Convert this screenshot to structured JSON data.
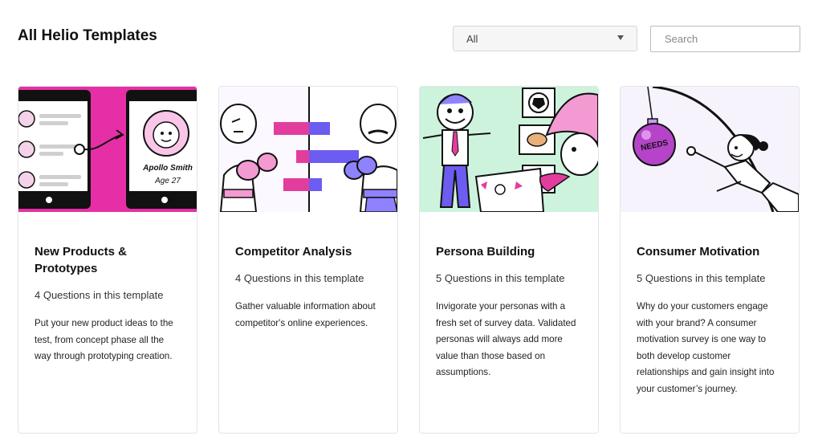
{
  "header": {
    "title": "All Helio Templates",
    "filter_value": "All",
    "search_placeholder": "Search"
  },
  "cards": [
    {
      "title": "New Products & Prototypes",
      "questions": "4 Questions in this template",
      "description": "Put your new product ideas to the test, from concept phase all the way through prototyping creation.",
      "thumb_text_name": "Apollo Smith",
      "thumb_text_age": "Age 27",
      "thumb_bg": "#e62fa6"
    },
    {
      "title": "Competitor Analysis",
      "questions": "4 Questions in this template",
      "description": "Gather valuable information about competitor's online experiences.",
      "thumb_bg": "#f4f0ff"
    },
    {
      "title": "Persona Building",
      "questions": "5 Questions in this template",
      "description": "Invigorate your personas with a fresh set of survey data. Validated personas will always add more value than those based on assumptions.",
      "thumb_bg": "#cdf3dc"
    },
    {
      "title": "Consumer Motivation",
      "questions": "5 Questions in this template",
      "description": "Why do your customers engage with your brand? A consumer motivation survey is one way to both develop customer relationships and gain insight into your customer’s journey.",
      "thumb_badge": "NEEDS",
      "thumb_bg": "#f6f3fc"
    }
  ]
}
